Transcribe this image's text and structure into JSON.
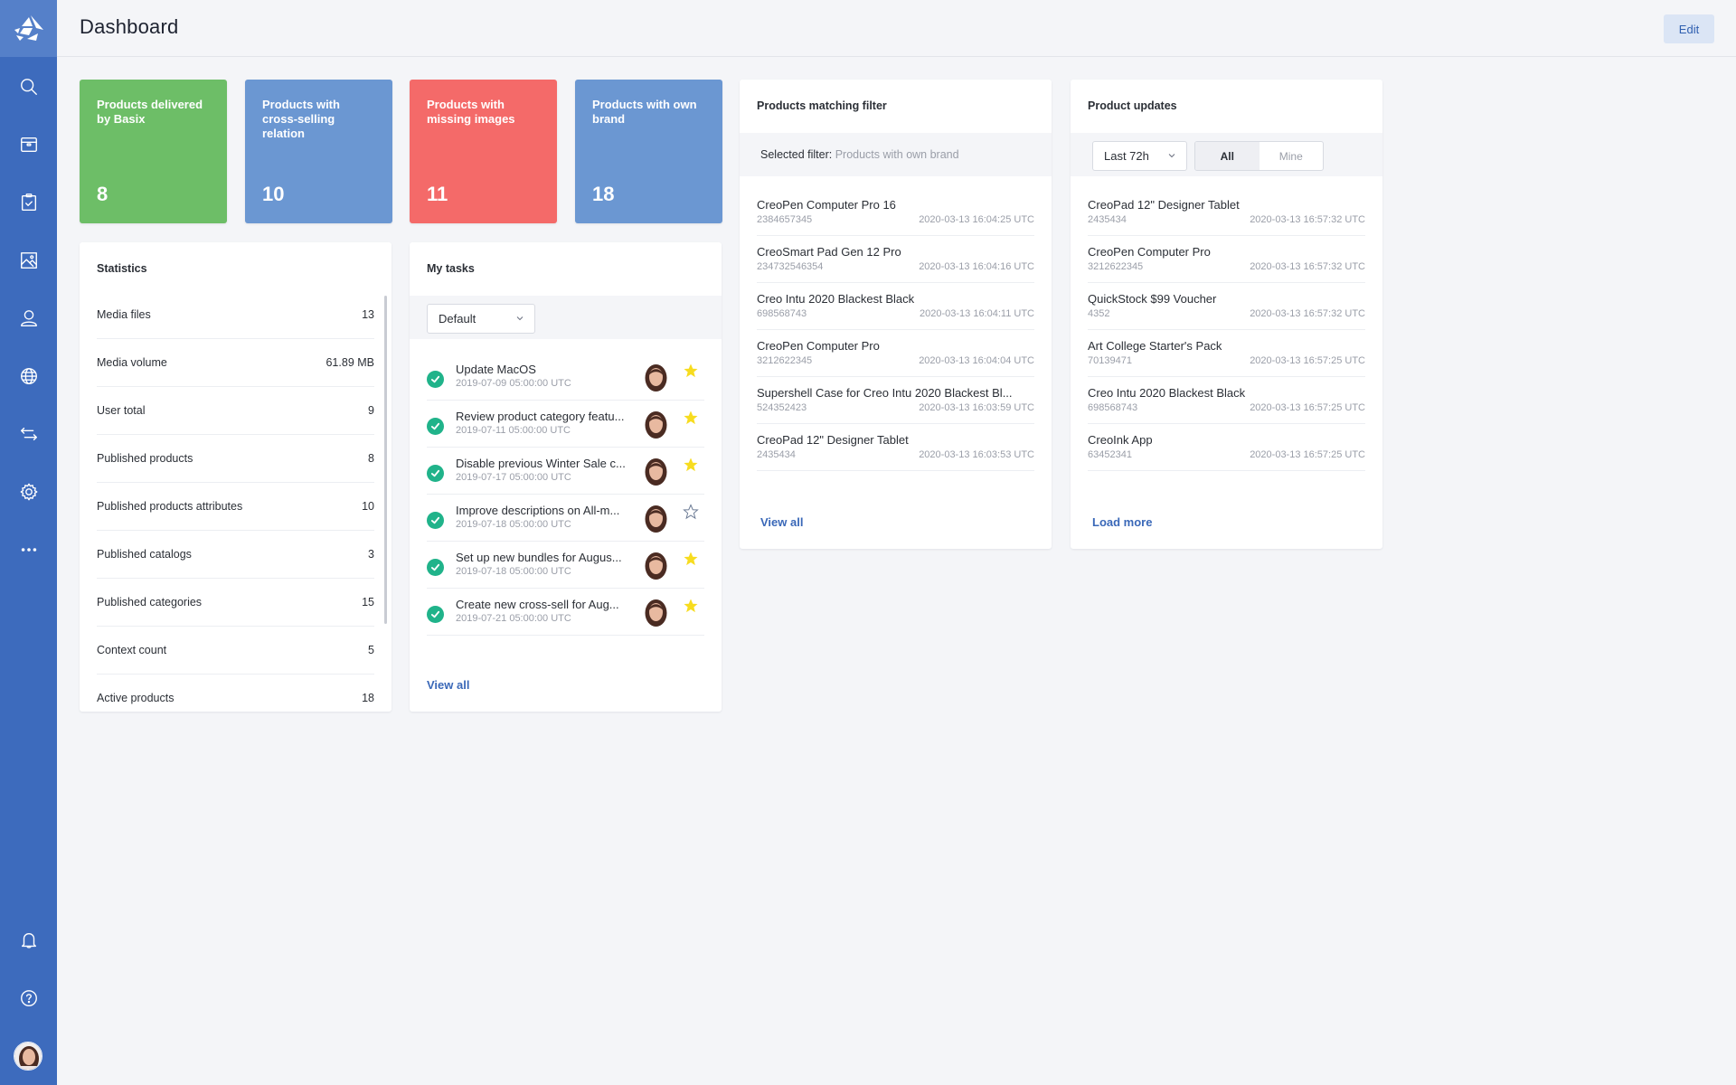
{
  "app": {
    "logo_icon": "basix-logo-icon",
    "colors": {
      "sidebar": "#3d6bbd",
      "logo_bg": "#5580c9",
      "green": "#6dbe67",
      "blue": "#6b97d2",
      "red": "#f46a69",
      "link": "#3a68b8",
      "check": "#20b38a",
      "star": "#f7dc1f"
    }
  },
  "sidebar": {
    "items": [
      {
        "name": "search",
        "icon": "search-icon"
      },
      {
        "name": "products",
        "icon": "box-icon"
      },
      {
        "name": "tasks",
        "icon": "clipboard-check-icon"
      },
      {
        "name": "media",
        "icon": "image-icon"
      },
      {
        "name": "users",
        "icon": "user-icon"
      },
      {
        "name": "channels",
        "icon": "globe-icon"
      },
      {
        "name": "import-export",
        "icon": "arrows-exchange-icon"
      },
      {
        "name": "settings",
        "icon": "gear-icon"
      },
      {
        "name": "more",
        "icon": "more-dots-icon"
      }
    ],
    "bottom": [
      {
        "name": "notifications",
        "icon": "bell-icon"
      },
      {
        "name": "help",
        "icon": "help-icon"
      },
      {
        "name": "profile",
        "icon": "avatar"
      }
    ]
  },
  "header": {
    "title": "Dashboard",
    "edit_label": "Edit"
  },
  "tiles": [
    {
      "label": "Products delivered by Basix",
      "value": "8",
      "color": "#6dbe67"
    },
    {
      "label": "Products with cross-selling relation",
      "value": "10",
      "color": "#6b97d2"
    },
    {
      "label": "Products with missing images",
      "value": "11",
      "color": "#f46a69"
    },
    {
      "label": "Products with own brand",
      "value": "18",
      "color": "#6b97d2"
    }
  ],
  "statistics": {
    "title": "Statistics",
    "rows": [
      {
        "label": "Media files",
        "value": "13"
      },
      {
        "label": "Media volume",
        "value": "61.89 MB"
      },
      {
        "label": "User total",
        "value": "9"
      },
      {
        "label": "Published products",
        "value": "8"
      },
      {
        "label": "Published products attributes",
        "value": "10"
      },
      {
        "label": "Published catalogs",
        "value": "3"
      },
      {
        "label": "Published categories",
        "value": "15"
      },
      {
        "label": "Context count",
        "value": "5"
      },
      {
        "label": "Active products",
        "value": "18"
      }
    ]
  },
  "tasks": {
    "title": "My tasks",
    "filter_value": "Default",
    "items": [
      {
        "name": "Update MacOS",
        "date": "2019-07-09 05:00:00 UTC",
        "done": true,
        "starred": true
      },
      {
        "name": "Review product category featu...",
        "date": "2019-07-11 05:00:00 UTC",
        "done": true,
        "starred": true
      },
      {
        "name": "Disable previous Winter Sale c...",
        "date": "2019-07-17 05:00:00 UTC",
        "done": true,
        "starred": true
      },
      {
        "name": "Improve descriptions on All-m...",
        "date": "2019-07-18 05:00:00 UTC",
        "done": true,
        "starred": false
      },
      {
        "name": "Set up new bundles for Augus...",
        "date": "2019-07-18 05:00:00 UTC",
        "done": true,
        "starred": true
      },
      {
        "name": "Create new cross-sell for Aug...",
        "date": "2019-07-21 05:00:00 UTC",
        "done": true,
        "starred": true
      }
    ],
    "view_all_label": "View all"
  },
  "matching": {
    "title": "Products matching filter",
    "filter_label": "Selected filter:",
    "filter_value": "Products with own brand",
    "items": [
      {
        "name": "CreoPen Computer Pro 16",
        "id": "2384657345",
        "time": "2020-03-13 16:04:25 UTC"
      },
      {
        "name": "CreoSmart Pad Gen 12 Pro",
        "id": "234732546354",
        "time": "2020-03-13 16:04:16 UTC"
      },
      {
        "name": "Creo Intu 2020 Blackest Black",
        "id": "698568743",
        "time": "2020-03-13 16:04:11 UTC"
      },
      {
        "name": "CreoPen Computer Pro",
        "id": "3212622345",
        "time": "2020-03-13 16:04:04 UTC"
      },
      {
        "name": "Supershell Case for Creo Intu 2020 Blackest Bl...",
        "id": "524352423",
        "time": "2020-03-13 16:03:59 UTC"
      },
      {
        "name": "CreoPad 12\" Designer Tablet",
        "id": "2435434",
        "time": "2020-03-13 16:03:53 UTC"
      }
    ],
    "view_all_label": "View all"
  },
  "updates": {
    "title": "Product updates",
    "range_value": "Last 72h",
    "toggle": {
      "all": "All",
      "mine": "Mine",
      "selected": "All"
    },
    "items": [
      {
        "name": "CreoPad 12\" Designer Tablet",
        "id": "2435434",
        "time": "2020-03-13 16:57:32 UTC"
      },
      {
        "name": "CreoPen Computer Pro",
        "id": "3212622345",
        "time": "2020-03-13 16:57:32 UTC"
      },
      {
        "name": "QuickStock $99 Voucher",
        "id": "4352",
        "time": "2020-03-13 16:57:32 UTC"
      },
      {
        "name": "Art College Starter's Pack",
        "id": "70139471",
        "time": "2020-03-13 16:57:25 UTC"
      },
      {
        "name": "Creo Intu 2020 Blackest Black",
        "id": "698568743",
        "time": "2020-03-13 16:57:25 UTC"
      },
      {
        "name": "CreoInk App",
        "id": "63452341",
        "time": "2020-03-13 16:57:25 UTC"
      }
    ],
    "load_more_label": "Load more"
  }
}
